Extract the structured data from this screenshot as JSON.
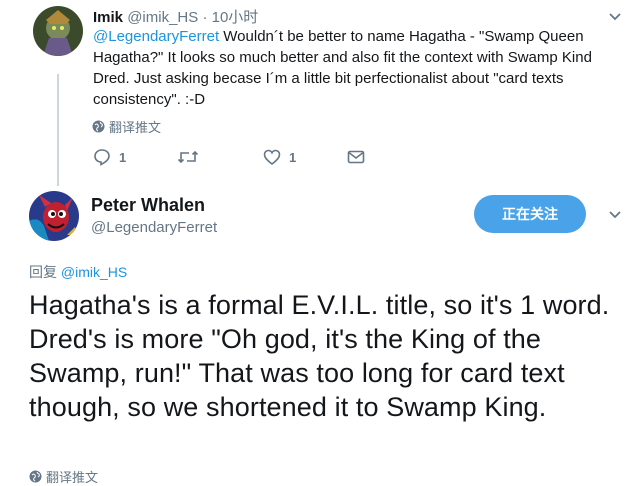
{
  "tweet1": {
    "name": "Imik",
    "handle": "@imik_HS",
    "separator": "·",
    "time": "10小时",
    "mention": "@LegendaryFerret",
    "text": " Wouldn´t be better to name Hagatha - \"Swamp Queen Hagatha?\" It looks so much better and also fit the context with Swamp Kind Dred. Just asking becase I´m a little bit perfectionalist about \"card texts consistency\". :-D",
    "translate_label": "翻译推文",
    "reply_count": "1",
    "like_count": "1"
  },
  "tweet2": {
    "name": "Peter Whalen",
    "handle": "@LegendaryFerret",
    "follow_label": "正在关注",
    "reply_prefix": "回复 ",
    "reply_mention": "@imik_HS",
    "text": "Hagatha's is a formal E.V.I.L. title, so it's 1 word.  Dred's is more \"Oh god, it's the King of the Swamp, run!\" That was too long for card text though, so we shortened it to Swamp King.",
    "translate_label": "翻译推文"
  },
  "colors": {
    "accent": "#1b95e0",
    "follow_button": "#4aa3e8",
    "secondary_text": "#657786",
    "thread_line": "#ccd6dd"
  },
  "icons": [
    "globe-icon",
    "reply-icon",
    "retweet-icon",
    "like-icon",
    "message-icon",
    "chevron-down-icon"
  ]
}
